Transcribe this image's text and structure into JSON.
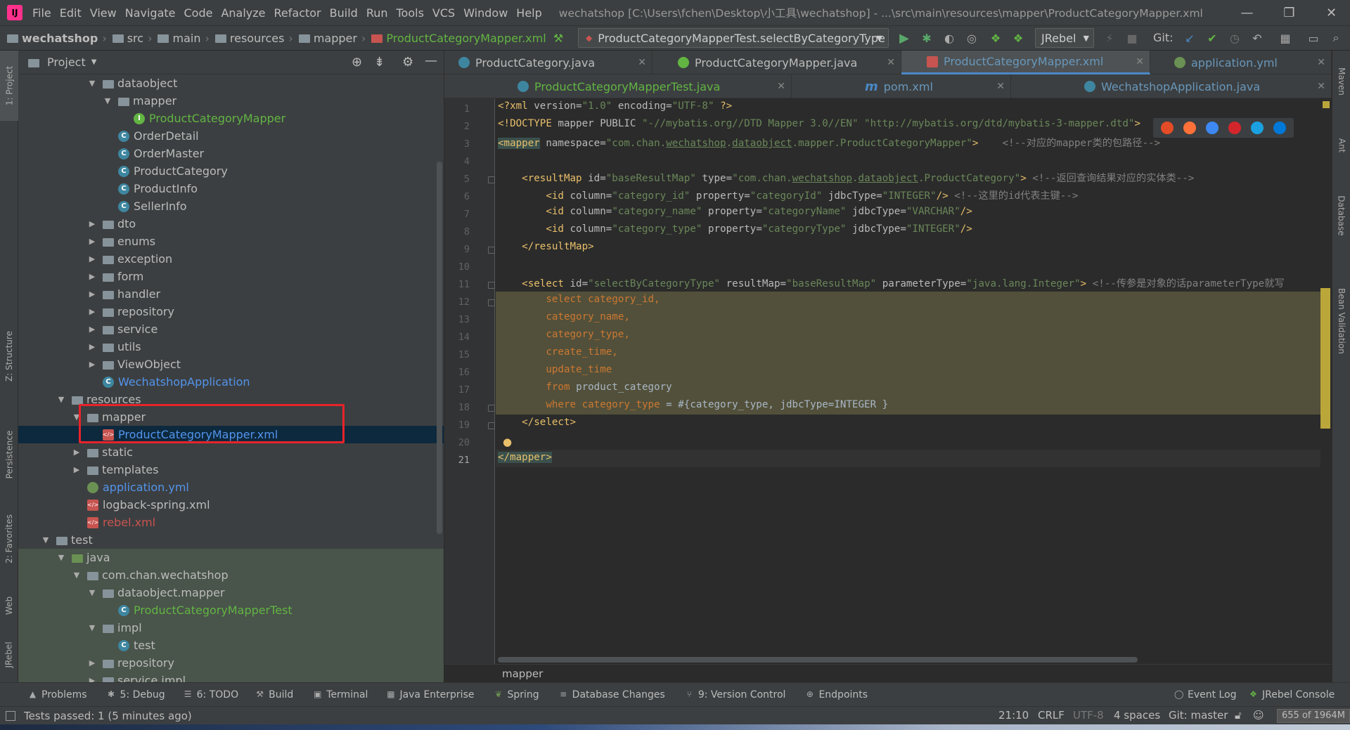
{
  "menu": {
    "logo": "IJ",
    "items": [
      "File",
      "Edit",
      "View",
      "Navigate",
      "Code",
      "Analyze",
      "Refactor",
      "Build",
      "Run",
      "Tools",
      "VCS",
      "Window",
      "Help"
    ],
    "window_title": "wechatshop [C:\\Users\\fchen\\Desktop\\小工具\\wechatshop] - ...\\src\\main\\resources\\mapper\\ProductCategoryMapper.xml"
  },
  "nav": {
    "breadcrumbs": [
      "wechatshop",
      "src",
      "main",
      "resources",
      "mapper",
      "ProductCategoryMapper.xml"
    ],
    "run_config": "ProductCategoryMapperTest.selectByCategoryType",
    "jrebel": "JRebel",
    "git_label": "Git:"
  },
  "left_tool_tabs": [
    "1: Project",
    "Z: Structure",
    "Persistence",
    "2: Favorites",
    "Web",
    "JRebel"
  ],
  "right_tool_tabs": [
    "Maven",
    "Ant",
    "Database",
    "Bean Validation"
  ],
  "project": {
    "title": "Project",
    "tree": [
      {
        "label": "dataobject",
        "indent": 5,
        "arrow": "▼",
        "icon": "folder"
      },
      {
        "label": "mapper",
        "indent": 6,
        "arrow": "▼",
        "icon": "folder"
      },
      {
        "label": "ProductCategoryMapper",
        "indent": 7,
        "arrow": "",
        "icon": "interface",
        "color": "green"
      },
      {
        "label": "OrderDetail",
        "indent": 6,
        "arrow": "",
        "icon": "class"
      },
      {
        "label": "OrderMaster",
        "indent": 6,
        "arrow": "",
        "icon": "class"
      },
      {
        "label": "ProductCategory",
        "indent": 6,
        "arrow": "",
        "icon": "class"
      },
      {
        "label": "ProductInfo",
        "indent": 6,
        "arrow": "",
        "icon": "class"
      },
      {
        "label": "SellerInfo",
        "indent": 6,
        "arrow": "",
        "icon": "class"
      },
      {
        "label": "dto",
        "indent": 5,
        "arrow": "▶",
        "icon": "folder"
      },
      {
        "label": "enums",
        "indent": 5,
        "arrow": "▶",
        "icon": "folder"
      },
      {
        "label": "exception",
        "indent": 5,
        "arrow": "▶",
        "icon": "folder"
      },
      {
        "label": "form",
        "indent": 5,
        "arrow": "▶",
        "icon": "folder"
      },
      {
        "label": "handler",
        "indent": 5,
        "arrow": "▶",
        "icon": "folder"
      },
      {
        "label": "repository",
        "indent": 5,
        "arrow": "▶",
        "icon": "folder"
      },
      {
        "label": "service",
        "indent": 5,
        "arrow": "▶",
        "icon": "folder"
      },
      {
        "label": "utils",
        "indent": 5,
        "arrow": "▶",
        "icon": "folder"
      },
      {
        "label": "ViewObject",
        "indent": 5,
        "arrow": "▶",
        "icon": "folder"
      },
      {
        "label": "WechatshopApplication",
        "indent": 5,
        "arrow": "",
        "icon": "class",
        "color": "blue"
      },
      {
        "label": "resources",
        "indent": 3,
        "arrow": "▼",
        "icon": "folder"
      },
      {
        "label": "mapper",
        "indent": 4,
        "arrow": "▼",
        "icon": "folder"
      },
      {
        "label": "ProductCategoryMapper.xml",
        "indent": 5,
        "arrow": "",
        "icon": "xml",
        "color": "blue",
        "selected": true
      },
      {
        "label": "static",
        "indent": 4,
        "arrow": "▶",
        "icon": "folder"
      },
      {
        "label": "templates",
        "indent": 4,
        "arrow": "▶",
        "icon": "folder"
      },
      {
        "label": "application.yml",
        "indent": 4,
        "arrow": "",
        "icon": "yml",
        "color": "blue"
      },
      {
        "label": "logback-spring.xml",
        "indent": 4,
        "arrow": "",
        "icon": "xml"
      },
      {
        "label": "rebel.xml",
        "indent": 4,
        "arrow": "",
        "icon": "xml",
        "color": "red"
      },
      {
        "label": "test",
        "indent": 2,
        "arrow": "▼",
        "icon": "folder"
      },
      {
        "label": "java",
        "indent": 3,
        "arrow": "▼",
        "icon": "folder-green",
        "test": true
      },
      {
        "label": "com.chan.wechatshop",
        "indent": 4,
        "arrow": "▼",
        "icon": "folder",
        "test": true
      },
      {
        "label": "dataobject.mapper",
        "indent": 5,
        "arrow": "▼",
        "icon": "folder",
        "test": true
      },
      {
        "label": "ProductCategoryMapperTest",
        "indent": 6,
        "arrow": "",
        "icon": "class",
        "color": "green",
        "test": true
      },
      {
        "label": "impl",
        "indent": 5,
        "arrow": "▼",
        "icon": "folder",
        "test": true
      },
      {
        "label": "test",
        "indent": 6,
        "arrow": "",
        "icon": "class",
        "test": true
      },
      {
        "label": "repository",
        "indent": 5,
        "arrow": "▶",
        "icon": "folder",
        "test": true
      },
      {
        "label": "service.impl",
        "indent": 5,
        "arrow": "▶",
        "icon": "folder",
        "test": true
      }
    ]
  },
  "tabs_row1": [
    {
      "label": "ProductCategory.java",
      "icon": "class"
    },
    {
      "label": "ProductCategoryMapper.java",
      "icon": "interface"
    },
    {
      "label": "ProductCategoryMapper.xml",
      "icon": "xml",
      "active": true
    },
    {
      "label": "application.yml",
      "icon": "yml"
    }
  ],
  "tabs_row2": [
    {
      "label": "ProductCategoryMapperTest.java",
      "icon": "class"
    },
    {
      "label": "pom.xml",
      "icon": "maven"
    },
    {
      "label": "WechatshopApplication.java",
      "icon": "class"
    }
  ],
  "editor": {
    "current_line": 21,
    "line_count": 21,
    "breadcrumb": "mapper"
  },
  "bottom_tabs": [
    "Problems",
    "5: Debug",
    "6: TODO",
    "Build",
    "Terminal",
    "Java Enterprise",
    "Spring",
    "Database Changes",
    "9: Version Control",
    "Endpoints"
  ],
  "bottom_right_tabs": [
    "Event Log",
    "JRebel Console"
  ],
  "status": {
    "message": "Tests passed: 1 (5 minutes ago)",
    "position": "21:10",
    "line_sep": "CRLF",
    "encoding": "UTF-8",
    "indent": "4 spaces",
    "git": "Git: master",
    "memory": "655 of 1964M"
  }
}
